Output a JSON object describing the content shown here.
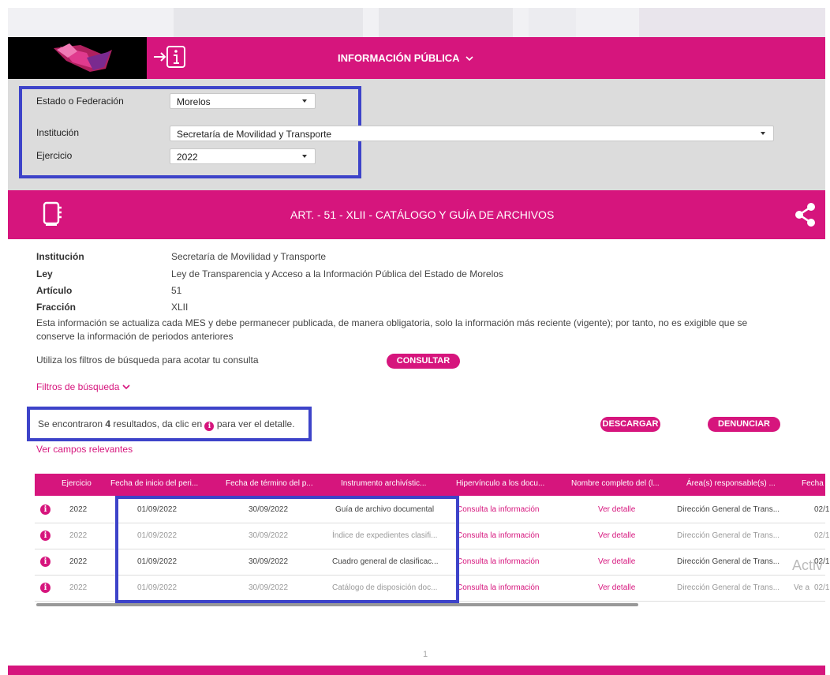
{
  "header": {
    "nav_title": "INFORMACIÓN PÚBLICA"
  },
  "filters": {
    "estado_label": "Estado o Federación",
    "estado_value": "Morelos",
    "institucion_label": "Institución",
    "institucion_value": "Secretaría de Movilidad y Transporte",
    "ejercicio_label": "Ejercicio",
    "ejercicio_value": "2022"
  },
  "article": {
    "title": "ART. - 51 - XLII - CATÁLOGO Y GUÍA DE ARCHIVOS"
  },
  "details": {
    "institucion_label": "Institución",
    "institucion_value": "Secretaría de Movilidad y Transporte",
    "ley_label": "Ley",
    "ley_value": "Ley de Transparencia y Acceso a la Información Pública del Estado de Morelos",
    "articulo_label": "Artículo",
    "articulo_value": "51",
    "fraccion_label": "Fracción",
    "fraccion_value": "XLII",
    "note_line1": "Esta información se actualiza cada MES y debe permanecer publicada, de manera obligatoria, solo la información más reciente (vigente); por tanto, no es exigible que se",
    "note_line2": "conserve la información de periodos anteriores",
    "search_hint": "Utiliza los filtros de búsqueda para acotar tu consulta",
    "consultar_label": "CONSULTAR",
    "filtros_link": "Filtros de búsqueda"
  },
  "results": {
    "prefix": "Se encontraron ",
    "count": "4",
    "middle": " resultados, da clic en ",
    "suffix": " para ver el detalle.",
    "descargar_label": "DESCARGAR",
    "denunciar_label": "DENUNCIAR",
    "campos_link": "Ver campos relevantes"
  },
  "table": {
    "columns": [
      "Ejercicio",
      "Fecha de inicio del peri...",
      "Fecha de término del p...",
      "Instrumento archivístic...",
      "Hipervínculo a los docu...",
      "Nombre completo del (l...",
      "Área(s) responsable(s) ...",
      "Fecha d"
    ],
    "rows": [
      {
        "ejercicio": "2022",
        "inicio": "01/09/2022",
        "termino": "30/09/2022",
        "instrumento": "Guía de archivo documental",
        "hipervinculo": "Consulta la información",
        "nombre": "Ver detalle",
        "area": "Dirección General de Trans...",
        "fecha": "02/1"
      },
      {
        "ejercicio": "2022",
        "inicio": "01/09/2022",
        "termino": "30/09/2022",
        "instrumento": "Índice de expedientes clasifi...",
        "hipervinculo": "Consulta la información",
        "nombre": "Ver detalle",
        "area": "Dirección General de Trans...",
        "fecha": "02/1"
      },
      {
        "ejercicio": "2022",
        "inicio": "01/09/2022",
        "termino": "30/09/2022",
        "instrumento": "Cuadro general de clasificac...",
        "hipervinculo": "Consulta la información",
        "nombre": "Ver detalle",
        "area": "Dirección General de Trans...",
        "fecha": "02/1"
      },
      {
        "ejercicio": "2022",
        "inicio": "01/09/2022",
        "termino": "30/09/2022",
        "instrumento": "Catálogo de disposición doc...",
        "hipervinculo": "Consulta la información",
        "nombre": "Ver detalle",
        "area": "Dirección General de Trans...",
        "fecha": "02/1"
      }
    ]
  },
  "watermark": {
    "line1": "Activ",
    "line2": "Ve a"
  },
  "pagination": {
    "page": "1"
  },
  "colors": {
    "brand": "#d6157d",
    "highlight": "#3d43c9",
    "filters_bg": "#dcdcdc"
  },
  "icons": [
    "logo-icon",
    "info-login-icon",
    "chevron-down-icon",
    "document-icon",
    "share-icon",
    "info-icon"
  ]
}
